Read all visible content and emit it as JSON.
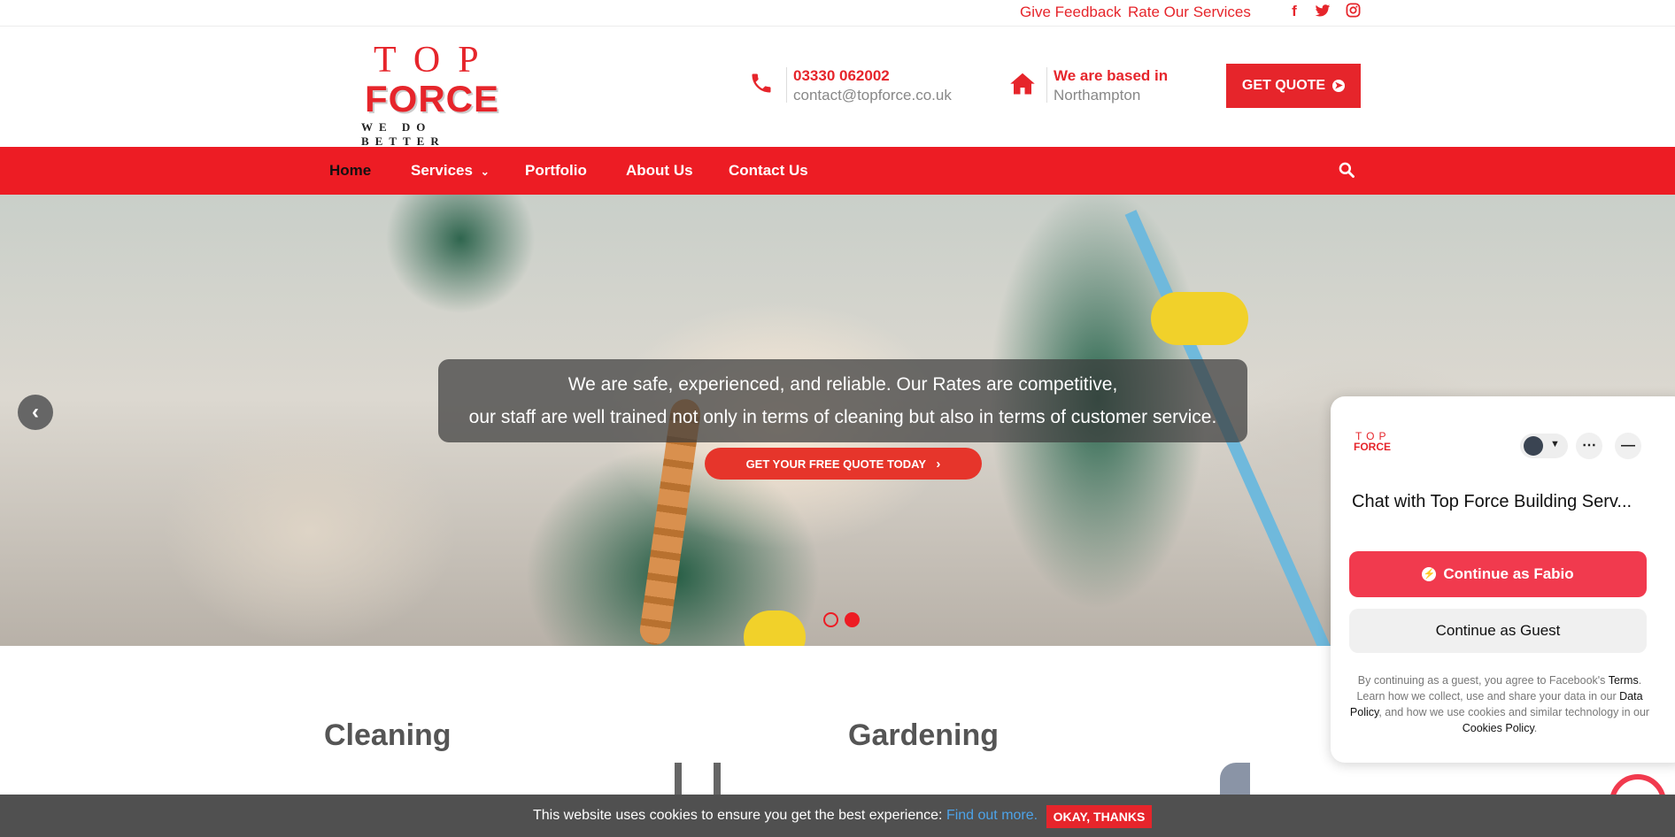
{
  "topbar": {
    "feedback_label": "Give Feedback",
    "rate_label": "Rate Our Services",
    "social_icons": [
      "facebook-icon",
      "twitter-icon",
      "instagram-icon"
    ]
  },
  "logo": {
    "line1": "TOP",
    "line2": "FORCE",
    "tagline": "WE DO BETTER"
  },
  "contact": {
    "phone": "03330 062002",
    "email": "contact@topforce.co.uk",
    "location_label": "We are based in",
    "location": "Northampton"
  },
  "header": {
    "get_quote_label": "GET QUOTE"
  },
  "nav": {
    "items": [
      {
        "label": "Home",
        "active": true
      },
      {
        "label": "Services",
        "has_dropdown": true
      },
      {
        "label": "Portfolio"
      },
      {
        "label": "About Us"
      },
      {
        "label": "Contact Us"
      }
    ]
  },
  "hero": {
    "caption_line1": "We are safe, experienced, and reliable. Our Rates are competitive,",
    "caption_line2": "our staff are well trained not only in terms of cleaning but also in terms of customer service.",
    "cta_label": "GET YOUR FREE QUOTE TODAY",
    "slides": 2,
    "active_slide": 2
  },
  "services": [
    {
      "title": "Cleaning"
    },
    {
      "title": "Gardening"
    }
  ],
  "chat": {
    "logo_line1": "TOP",
    "logo_line2": "FORCE",
    "title": "Chat with Top Force Building Serv...",
    "continue_as_user_label": "Continue as Fabio",
    "continue_as_guest_label": "Continue as Guest",
    "legal_1": "By continuing as a guest, you agree to Facebook's ",
    "legal_terms": "Terms",
    "legal_2": ". Learn how we collect, use and share your data in our ",
    "legal_data_policy": "Data Policy",
    "legal_3": ", and how we use cookies and similar technology in our ",
    "legal_cookies_policy": "Cookies Policy",
    "legal_4": "."
  },
  "cookie": {
    "message": "This website uses cookies to ensure you get the best experience: ",
    "link_label": "Find out more.",
    "ok_label": "OKAY, THANKS"
  },
  "colors": {
    "brand_red": "#ed1c24",
    "messenger_red": "#f13a4e",
    "cookie_bg": "#505050",
    "link_blue": "#4da3e8"
  }
}
